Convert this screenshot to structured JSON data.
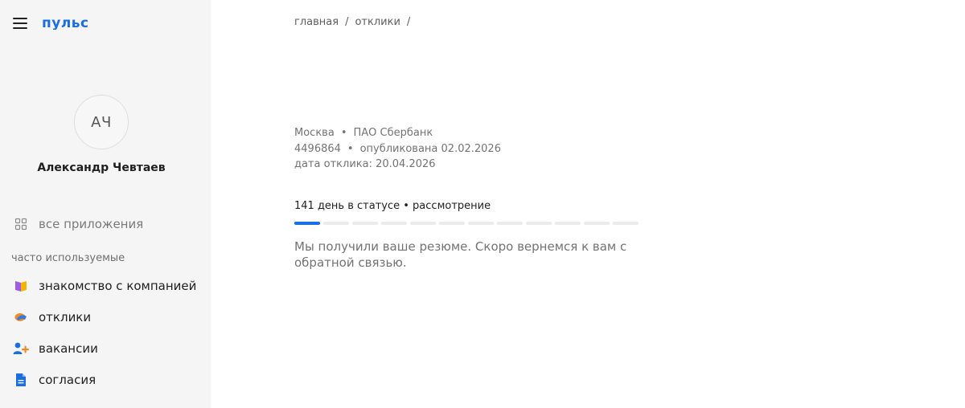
{
  "app": {
    "logo_text": "пульс",
    "brand_color": "#1a6ee3"
  },
  "user": {
    "initials": "АЧ",
    "name": "Александр Чевтаев"
  },
  "sidebar": {
    "all_apps": {
      "label": "все приложения",
      "icon": "grid-icon"
    },
    "section_title": "часто используемые",
    "items": [
      {
        "label": "знакомство с компанией",
        "icon": "book-icon"
      },
      {
        "label": "отклики",
        "icon": "handshake-icon"
      },
      {
        "label": "вакансии",
        "icon": "add-user-icon"
      },
      {
        "label": "согласия",
        "icon": "document-icon"
      }
    ]
  },
  "breadcrumb": {
    "items": [
      "главная",
      "отклики"
    ],
    "separator": "/"
  },
  "vacancy": {
    "city": "Москва",
    "company": "ПАО Сбербанк",
    "id": "4496864",
    "published": "опубликована 02.02.2026",
    "response_date": "дата отклика: 20.04.2026"
  },
  "status": {
    "text": "141 день в статусе • рассмотрение",
    "progress_total": 12,
    "progress_done": 1
  },
  "message": "Мы получили ваше резюме. Скоро вернемся к вам с обратной связью."
}
